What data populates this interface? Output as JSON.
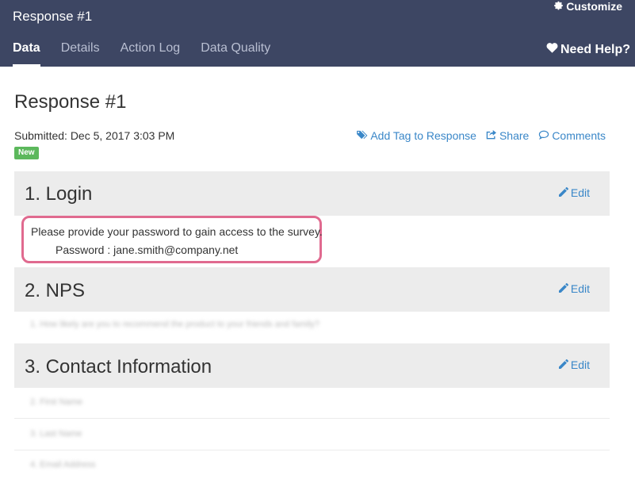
{
  "header": {
    "title": "Response #1",
    "customize_label": "Customize",
    "need_help_label": "Need Help?",
    "tabs": [
      {
        "label": "Data",
        "active": true
      },
      {
        "label": "Details",
        "active": false
      },
      {
        "label": "Action Log",
        "active": false
      },
      {
        "label": "Data Quality",
        "active": false
      }
    ]
  },
  "main": {
    "title": "Response #1",
    "submitted": "Submitted: Dec 5, 2017 3:03 PM",
    "badge": "New",
    "actions": {
      "add_tag": "Add Tag to Response",
      "share": "Share",
      "comments": "Comments"
    }
  },
  "sections": [
    {
      "title": "1. Login",
      "edit_label": "Edit",
      "question": "Please provide your password to gain access to the survey.",
      "answer": "Password : jane.smith@company.net"
    },
    {
      "title": "2. NPS",
      "edit_label": "Edit",
      "question": "1. How likely are you to recommend the product to your friends and family?"
    },
    {
      "title": "3. Contact Information",
      "edit_label": "Edit",
      "fields": [
        "2. First Name",
        "3. Last Name",
        "4. Email Address"
      ]
    }
  ],
  "colors": {
    "header_bg": "#3d4663",
    "link": "#3a87c8",
    "badge_bg": "#5cb85c",
    "highlight_border": "#e06a8f",
    "section_bg": "#ececec"
  }
}
